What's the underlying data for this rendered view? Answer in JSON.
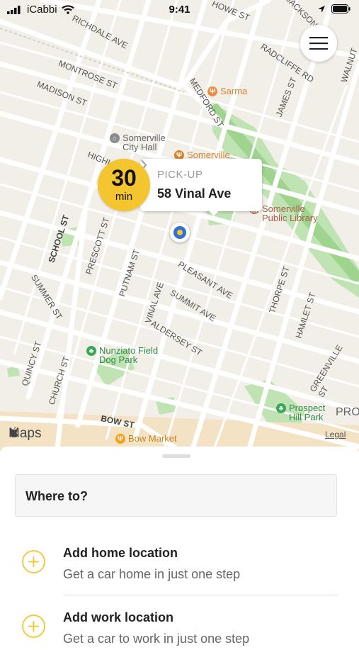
{
  "status_bar": {
    "carrier": "iCabbi",
    "time": "9:41"
  },
  "map": {
    "streets": [
      "HOWE ST",
      "JACKSON",
      "RICHDALE AVE",
      "MONTROSE ST",
      "MADISON ST",
      "RADCLIFFE RD",
      "MEDFORD ST",
      "JAMES ST",
      "WALNUT",
      "HIGHLAND",
      "SCHOOL ST",
      "PRESCOTT ST",
      "PUTNAM ST",
      "PLEASANT AVE",
      "SUMMIT AVE",
      "THORPE ST",
      "HAMLET ST",
      "SUMMER ST",
      "VINAL AVE",
      "ALDERSEY ST",
      "QUINCY ST",
      "CHURCH ST",
      "GREENVILLE ST",
      "BOW ST",
      "PRO"
    ],
    "pois": [
      {
        "name": "Sarma",
        "color": "#f08a3c"
      },
      {
        "name": "Somerville City Hall",
        "color": "#8a8a8a"
      },
      {
        "name": "Somerville",
        "color": "#d9822b"
      },
      {
        "name": "Somerville Public Library",
        "color": "#b5735a"
      },
      {
        "name": "Nunziato Field Dog Park",
        "color": "#3aa85a"
      },
      {
        "name": "Prospect Hill Park",
        "color": "#3aa85a"
      },
      {
        "name": "Bow Market",
        "color": "#f4a21e"
      }
    ],
    "attribution": "Maps",
    "legal": "Legal"
  },
  "pickup": {
    "eta_value": "30",
    "eta_unit": "min",
    "label": "PICK-UP",
    "address": "58 Vinal Ave"
  },
  "sheet": {
    "search_placeholder": "Where to?",
    "items": [
      {
        "title": "Add home location",
        "subtitle": "Get a car home in just one step"
      },
      {
        "title": "Add work location",
        "subtitle": "Get a car to work in just one step"
      }
    ]
  },
  "colors": {
    "accent": "#f4c52f",
    "pin": "#2f6fd6",
    "park": "#bfe3b3"
  }
}
